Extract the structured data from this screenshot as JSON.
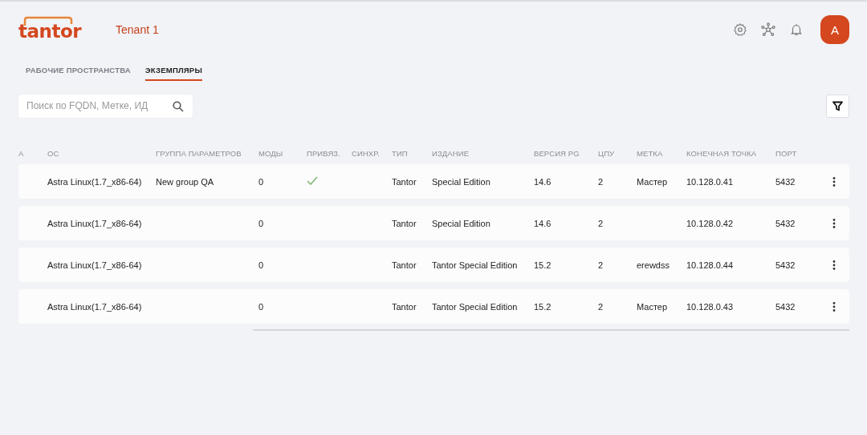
{
  "header": {
    "logo": "tantor",
    "tenant": "Tenant 1",
    "avatar": "A"
  },
  "tabs": [
    {
      "label": "РАБОЧИЕ ПРОСТРАНСТВА",
      "selected": false
    },
    {
      "label": "ЭКЗЕМПЛЯРЫ",
      "selected": true
    }
  ],
  "search": {
    "placeholder": "Поиск по FQDN, Метке, ИД"
  },
  "table": {
    "columns": [
      "А",
      "ОС",
      "ГРУППА ПАРАМЕТРОВ",
      "МОДЫ",
      "ПРИВЯЗ.",
      "СИНХР.",
      "ТИП",
      "ИЗДАНИЕ",
      "ВЕРСИЯ PG",
      "ЦПУ",
      "МЕТКА",
      "КОНЕЧНАЯ ТОЧКА",
      "ПОРТ"
    ],
    "rows": [
      {
        "os": "Astra Linux(1.7_x86-64)",
        "group": "New group QA",
        "mods": "0",
        "bound": true,
        "type": "Tantor",
        "edition": "Special Edition",
        "pg": "14.6",
        "cpu": "2",
        "label": "Мастер",
        "endpoint": "10.128.0.41",
        "port": "5432"
      },
      {
        "os": "Astra Linux(1.7_x86-64)",
        "mods": "0",
        "bound": false,
        "type": "Tantor",
        "edition": "Special Edition",
        "pg": "14.6",
        "cpu": "2",
        "endpoint": "10.128.0.42",
        "port": "5432"
      },
      {
        "os": "Astra Linux(1.7_x86-64)",
        "mods": "0",
        "bound": false,
        "type": "Tantor",
        "edition": "Tantor Special Edition",
        "pg": "15.2",
        "cpu": "2",
        "label": "erewdss",
        "endpoint": "10.128.0.44",
        "port": "5432"
      },
      {
        "os": "Astra Linux(1.7_x86-64)",
        "mods": "0",
        "bound": false,
        "type": "Tantor",
        "edition": "Tantor Special Edition",
        "pg": "15.2",
        "cpu": "2",
        "label": "Мастер",
        "endpoint": "10.128.0.43",
        "port": "5432"
      }
    ]
  }
}
